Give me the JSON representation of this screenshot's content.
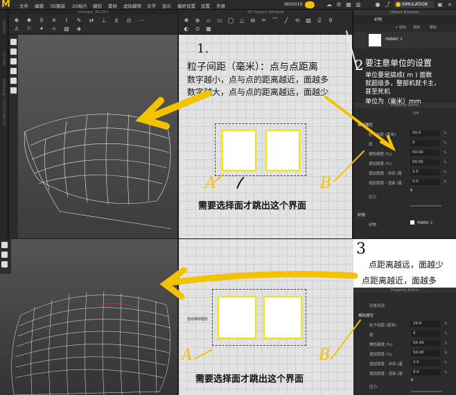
{
  "app": {
    "logo": "M",
    "menu": [
      "文件",
      "编辑",
      "3D服装",
      "2D板片",
      "缝纫",
      "素材",
      "虚拟模特",
      "文字",
      "显示",
      "偏好设置",
      "设置",
      "手册"
    ],
    "user_id": "i802010",
    "simulation_label": "SIMULATION"
  },
  "left_strip": [
    "LIBRARY",
    "HISTORY",
    "MODULAR CONFIGURATOR"
  ],
  "window3d": {
    "title": "Untitled_3D.ZPrj"
  },
  "window2d": {
    "title": "2D Pattern Window"
  },
  "object_browser": {
    "title": "Object Browser",
    "tabs": [
      "织物"
    ],
    "buttons": [
      "+ 增加",
      "复制",
      "删除"
    ],
    "fabric_name": "FABRIC 1"
  },
  "property_editor": {
    "title": "Property Editor",
    "toggle_label": "Off",
    "section_sim": "模拟属性",
    "rows": [
      {
        "label": "粒子间距 (毫米)",
        "value": "50.0"
      },
      {
        "label": "层",
        "value": "0"
      },
      {
        "label": "弹性硬度 (%)",
        "value": "50.00"
      },
      {
        "label": "增加厚度 (%)",
        "value": "50.00"
      },
      {
        "label": "增加厚度 - 冲突 (毫",
        "value": "2.5"
      },
      {
        "label": "增加厚度 - 渲染 (毫",
        "value": "0.0"
      },
      {
        "label": "",
        "value": "6"
      }
    ],
    "pressure_label": "压力",
    "section_fabric": "织物",
    "fabric_label": "织物",
    "fabric_value": "FABRIC 1"
  },
  "bottom_property_editor": {
    "title": "Property Editor",
    "toggle_label": "双重表现",
    "section_sim": "模拟属性",
    "rows": [
      {
        "label": "粒子间距 (毫米)",
        "value": "20.0"
      },
      {
        "label": "层",
        "value": "0"
      },
      {
        "label": "弹性硬度 (%)",
        "value": "50.00"
      },
      {
        "label": "增加厚度 (%)",
        "value": "50.00"
      },
      {
        "label": "增加厚度 - 冲突 (毫",
        "value": "2.5"
      },
      {
        "label": "增加厚度 - 渲染 (毫",
        "value": "0.0"
      },
      {
        "label": "",
        "value": "6"
      }
    ],
    "pressure_label": "压力"
  },
  "bottom2d_tag": "自动保存图形",
  "annotations": {
    "num1": "1.",
    "line1": "粒子间距（毫米）：点与点距离",
    "line2": "数字越小，点与点的距离越近，面越多",
    "line3": "数字越大，点与点的距离越远，面越少",
    "num2": "2",
    "unit_title": "要注意单位的设置",
    "unit_1": "单位要是搞成( m ) 面数",
    "unit_2": "就超级多，整部机就卡主，",
    "unit_3": "甚至死机",
    "unit_4": "单位为（毫米）mm",
    "note_select_top": "需要选择面才跳出这个界面",
    "note_select_bottom": "需要选择面才跳出这个界面",
    "num3": "3",
    "far_less": "点距离越远，面越少",
    "near_more": "点距离越近，面越多",
    "letter_a": "A",
    "letter_b": "B",
    "letter_a2": "A",
    "letter_b2": "B"
  },
  "colors": {
    "accent": "#f5c200",
    "pattern_border": "#f5e600"
  }
}
